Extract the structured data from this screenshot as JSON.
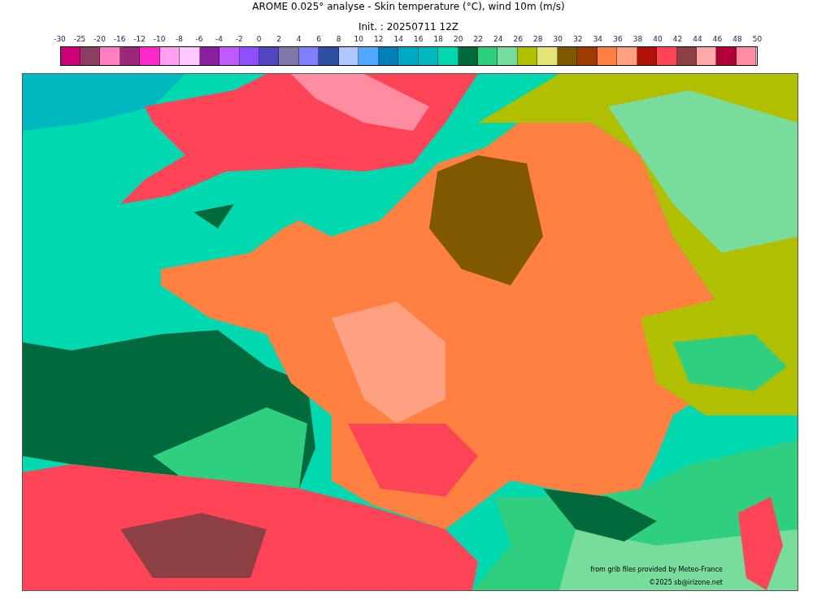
{
  "title": "AROME 0.025° analyse - Skin temperature (°C), wind 10m (m/s)",
  "subtitle": "Init. : 20250711 12Z",
  "colorbar": {
    "ticks": [
      "-30",
      "-25",
      "-20",
      "-16",
      "-12",
      "-10",
      "-8",
      "-6",
      "-4",
      "-2",
      "0",
      "2",
      "4",
      "6",
      "8",
      "10",
      "12",
      "14",
      "16",
      "18",
      "20",
      "22",
      "24",
      "26",
      "28",
      "30",
      "32",
      "34",
      "36",
      "38",
      "40",
      "42",
      "44",
      "46",
      "48",
      "50"
    ],
    "bins": [
      {
        "color": "#cc0077"
      },
      {
        "color": "#8b4060"
      },
      {
        "color": "#ff80c0"
      },
      {
        "color": "#9b2878"
      },
      {
        "color": "#ff28c8"
      },
      {
        "color": "#ffa0f0"
      },
      {
        "color": "#ffc8ff"
      },
      {
        "color": "#8c1ea0"
      },
      {
        "color": "#be5aff"
      },
      {
        "color": "#8c50ff"
      },
      {
        "color": "#5046be"
      },
      {
        "color": "#8078a8"
      },
      {
        "color": "#8080ff"
      },
      {
        "color": "#2e50a0"
      },
      {
        "color": "#b0c8ff"
      },
      {
        "color": "#50a8ff"
      },
      {
        "color": "#0080b8"
      },
      {
        "color": "#00a8c8"
      },
      {
        "color": "#00b8c0"
      },
      {
        "color": "#00d8b0"
      },
      {
        "color": "#006a3c"
      },
      {
        "color": "#2ed080"
      },
      {
        "color": "#78dc9c"
      },
      {
        "color": "#b0c000"
      },
      {
        "color": "#e4e478"
      },
      {
        "color": "#805800"
      },
      {
        "color": "#9c3c00"
      },
      {
        "color": "#ff8040"
      },
      {
        "color": "#ffa080"
      },
      {
        "color": "#b01008"
      },
      {
        "color": "#ff4458"
      },
      {
        "color": "#8c4044"
      },
      {
        "color": "#ffa8a8"
      },
      {
        "color": "#b40038"
      },
      {
        "color": "#ff8ca0"
      }
    ]
  },
  "credits": [
    "from grib files provided by Meteo-France",
    "©2025 sb@irizone.net"
  ]
}
